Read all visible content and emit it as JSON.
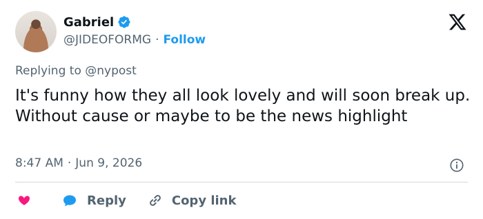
{
  "author": {
    "display_name": "Gabriel",
    "handle": "@JIDEOFORMG",
    "separator": "·",
    "follow_label": "Follow",
    "verified": true
  },
  "reply_context": {
    "prefix": "Replying to",
    "mention": "@nypost"
  },
  "tweet": {
    "text": "It's funny how they all look lovely and will soon break up. Without cause or maybe to be the news highlight"
  },
  "meta": {
    "time": "8:47 AM",
    "separator": "·",
    "date": "Jun 9, 2026"
  },
  "actions": {
    "reply_label": "Reply",
    "copy_link_label": "Copy link"
  },
  "icons": {
    "x_logo": "x-logo-icon",
    "verified": "verified-badge-icon",
    "info": "info-icon",
    "like": "heart-icon",
    "reply": "chat-bubble-icon",
    "copy": "link-icon"
  },
  "colors": {
    "accent": "#1d9bf0",
    "like": "#f91880",
    "secondary_text": "#536471",
    "primary_text": "#0f1419",
    "divider": "#cfd9de"
  }
}
